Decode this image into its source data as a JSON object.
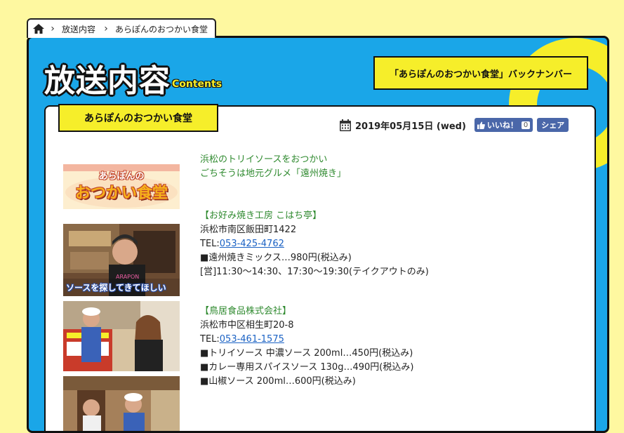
{
  "breadcrumb": {
    "items": [
      "放送内容",
      "あらぽんのおつかい食堂"
    ]
  },
  "header": {
    "title": "放送内容",
    "subtitle": "Contents",
    "backnumber_label": "「あらぽんのおつかい食堂」バックナンバー"
  },
  "section": {
    "title": "あらぽんのおつかい食堂",
    "date": "2019年05月15日 (wed)",
    "like_label": "いいね！",
    "like_count": "0",
    "share_label": "シェア"
  },
  "logo_text": [
    "あらぽんの",
    "おつかい食堂"
  ],
  "caption_overlay": "ソースを探してきてほしい",
  "intro": {
    "line1": "浜松のトリイソースをおつかい",
    "line2": "ごちそうは地元グルメ「遠州焼き」"
  },
  "shops": [
    {
      "name": "【お好み焼き工房 こはち亭】",
      "address": "浜松市南区飯田町1422",
      "tel_label": "TEL:",
      "tel": "053-425-4762",
      "items": [
        "■遠州焼きミックス…980円(税込み)",
        "[営]11:30～14:30、17:30～19:30(テイクアウトのみ)"
      ]
    },
    {
      "name": "【鳥居食品株式会社】",
      "address": "浜松市中区相生町20-8",
      "tel_label": "TEL:",
      "tel": "053-461-1575",
      "items": [
        "■トリイソース 中濃ソース 200ml…450円(税込み)",
        "■カレー専用スパイスソース 130g…490円(税込み)",
        "■山椒ソース 200ml…600円(税込み)"
      ]
    }
  ],
  "colors": {
    "background": "#fef8a0",
    "panel": "#1aa6e8",
    "accent": "#f6ee2a",
    "facebook": "#4a67a9",
    "link": "#1b62c4",
    "shop_name": "#2f8a2f"
  },
  "icons": [
    "home-icon",
    "calendar-icon",
    "thumbs-up-icon"
  ]
}
